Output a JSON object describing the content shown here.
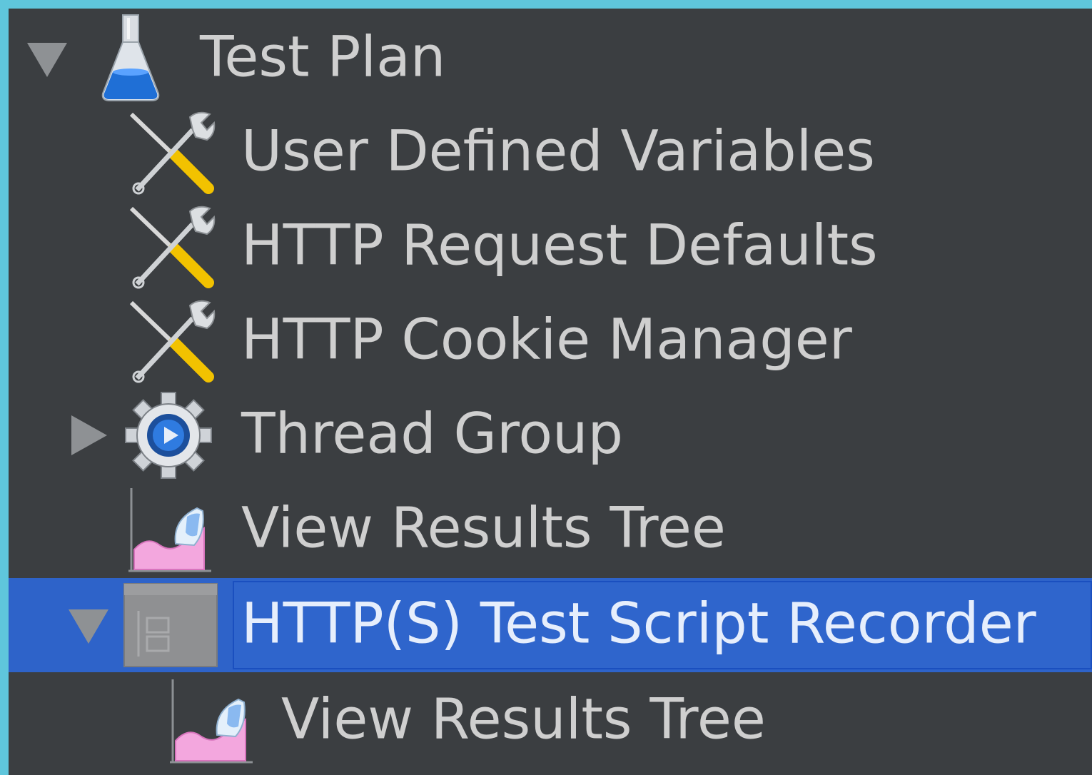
{
  "tree": {
    "items": [
      {
        "label": "Test Plan",
        "icon": "flask-icon",
        "expanded": true
      },
      {
        "label": "User Defined Variables",
        "icon": "config-tools-icon"
      },
      {
        "label": "HTTP Request Defaults",
        "icon": "config-tools-icon"
      },
      {
        "label": "HTTP Cookie Manager",
        "icon": "config-tools-icon"
      },
      {
        "label": "Thread Group",
        "icon": "gear-icon",
        "expanded": false
      },
      {
        "label": "View Results Tree",
        "icon": "results-chart-icon"
      },
      {
        "label": "HTTP(S) Test Script Recorder",
        "icon": "recorder-icon",
        "expanded": true,
        "selected": true
      },
      {
        "label": "View Results Tree",
        "icon": "results-chart-icon"
      }
    ]
  },
  "colors": {
    "border": "#5fc6dc",
    "background": "#3b3e41",
    "selection": "#2e63c9",
    "text": "#cfcfcf"
  }
}
